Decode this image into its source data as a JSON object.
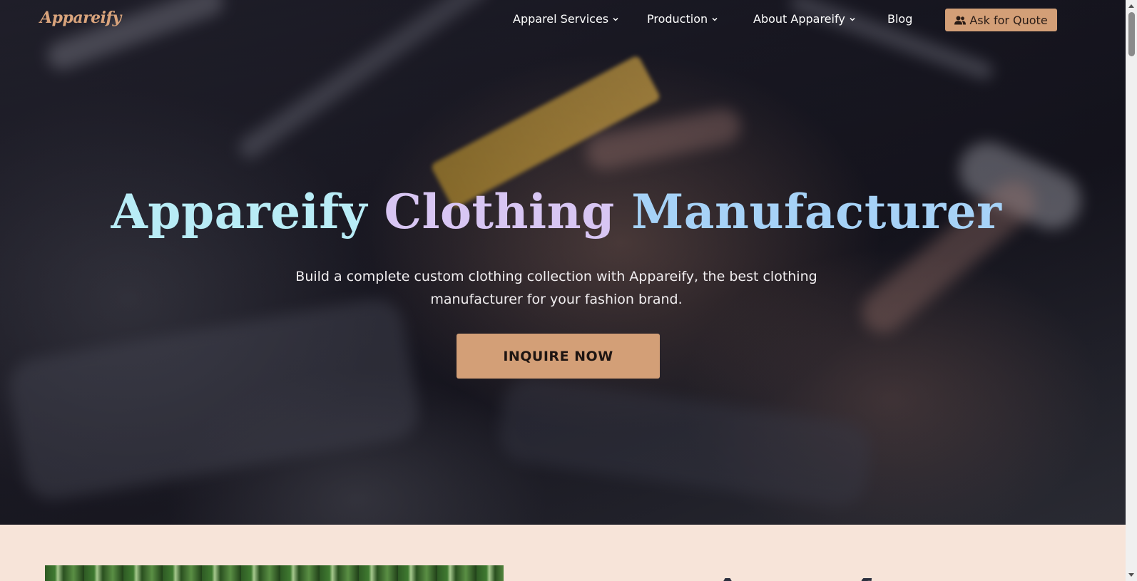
{
  "brand": {
    "logo_text": "Appareify",
    "accent_color": "#d39f77"
  },
  "nav": {
    "items": [
      {
        "label": "Apparel Services",
        "dropdown": true
      },
      {
        "label": "Production",
        "dropdown": true
      },
      {
        "label": "About Appareify",
        "dropdown": true
      },
      {
        "label": "Blog",
        "dropdown": false
      }
    ],
    "quote_button": {
      "label": "Ask for Quote",
      "icon": "users-icon"
    }
  },
  "hero": {
    "title_words": [
      "Appareify",
      "Clothing",
      "Manufacturer"
    ],
    "subtitle": "Build a complete custom clothing collection with Appareify, the best clothing manufacturer for your fashion brand.",
    "cta_label": "INQUIRE NOW"
  },
  "lower_section": {
    "heading_partial": "A... f...",
    "background_color": "#f7e4d9"
  }
}
